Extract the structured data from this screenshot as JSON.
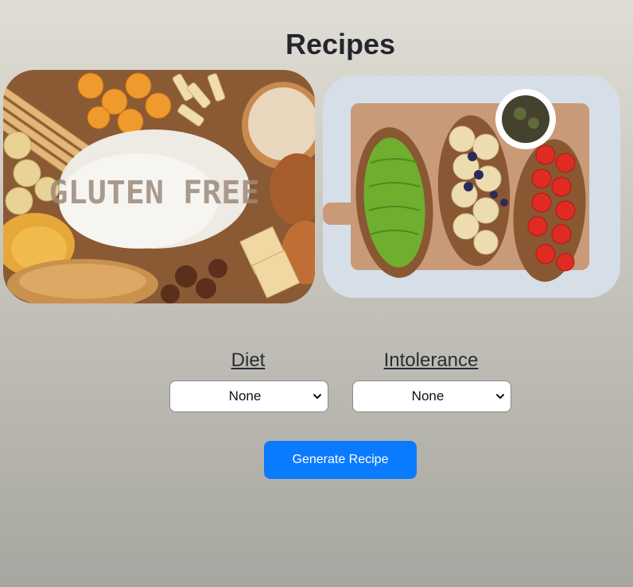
{
  "page": {
    "title": "Recipes"
  },
  "images": {
    "left": {
      "name": "gluten-free-foods-photo",
      "text": "GLUTEN FREE"
    },
    "right": {
      "name": "avocado-banana-tomato-toasts-photo"
    }
  },
  "filters": {
    "diet": {
      "label": "Diet",
      "selected": "None"
    },
    "intolerance": {
      "label": "Intolerance",
      "selected": "None"
    }
  },
  "actions": {
    "generate_label": "Generate Recipe"
  },
  "colors": {
    "accent": "#0a7bff",
    "heading": "#23262b"
  }
}
